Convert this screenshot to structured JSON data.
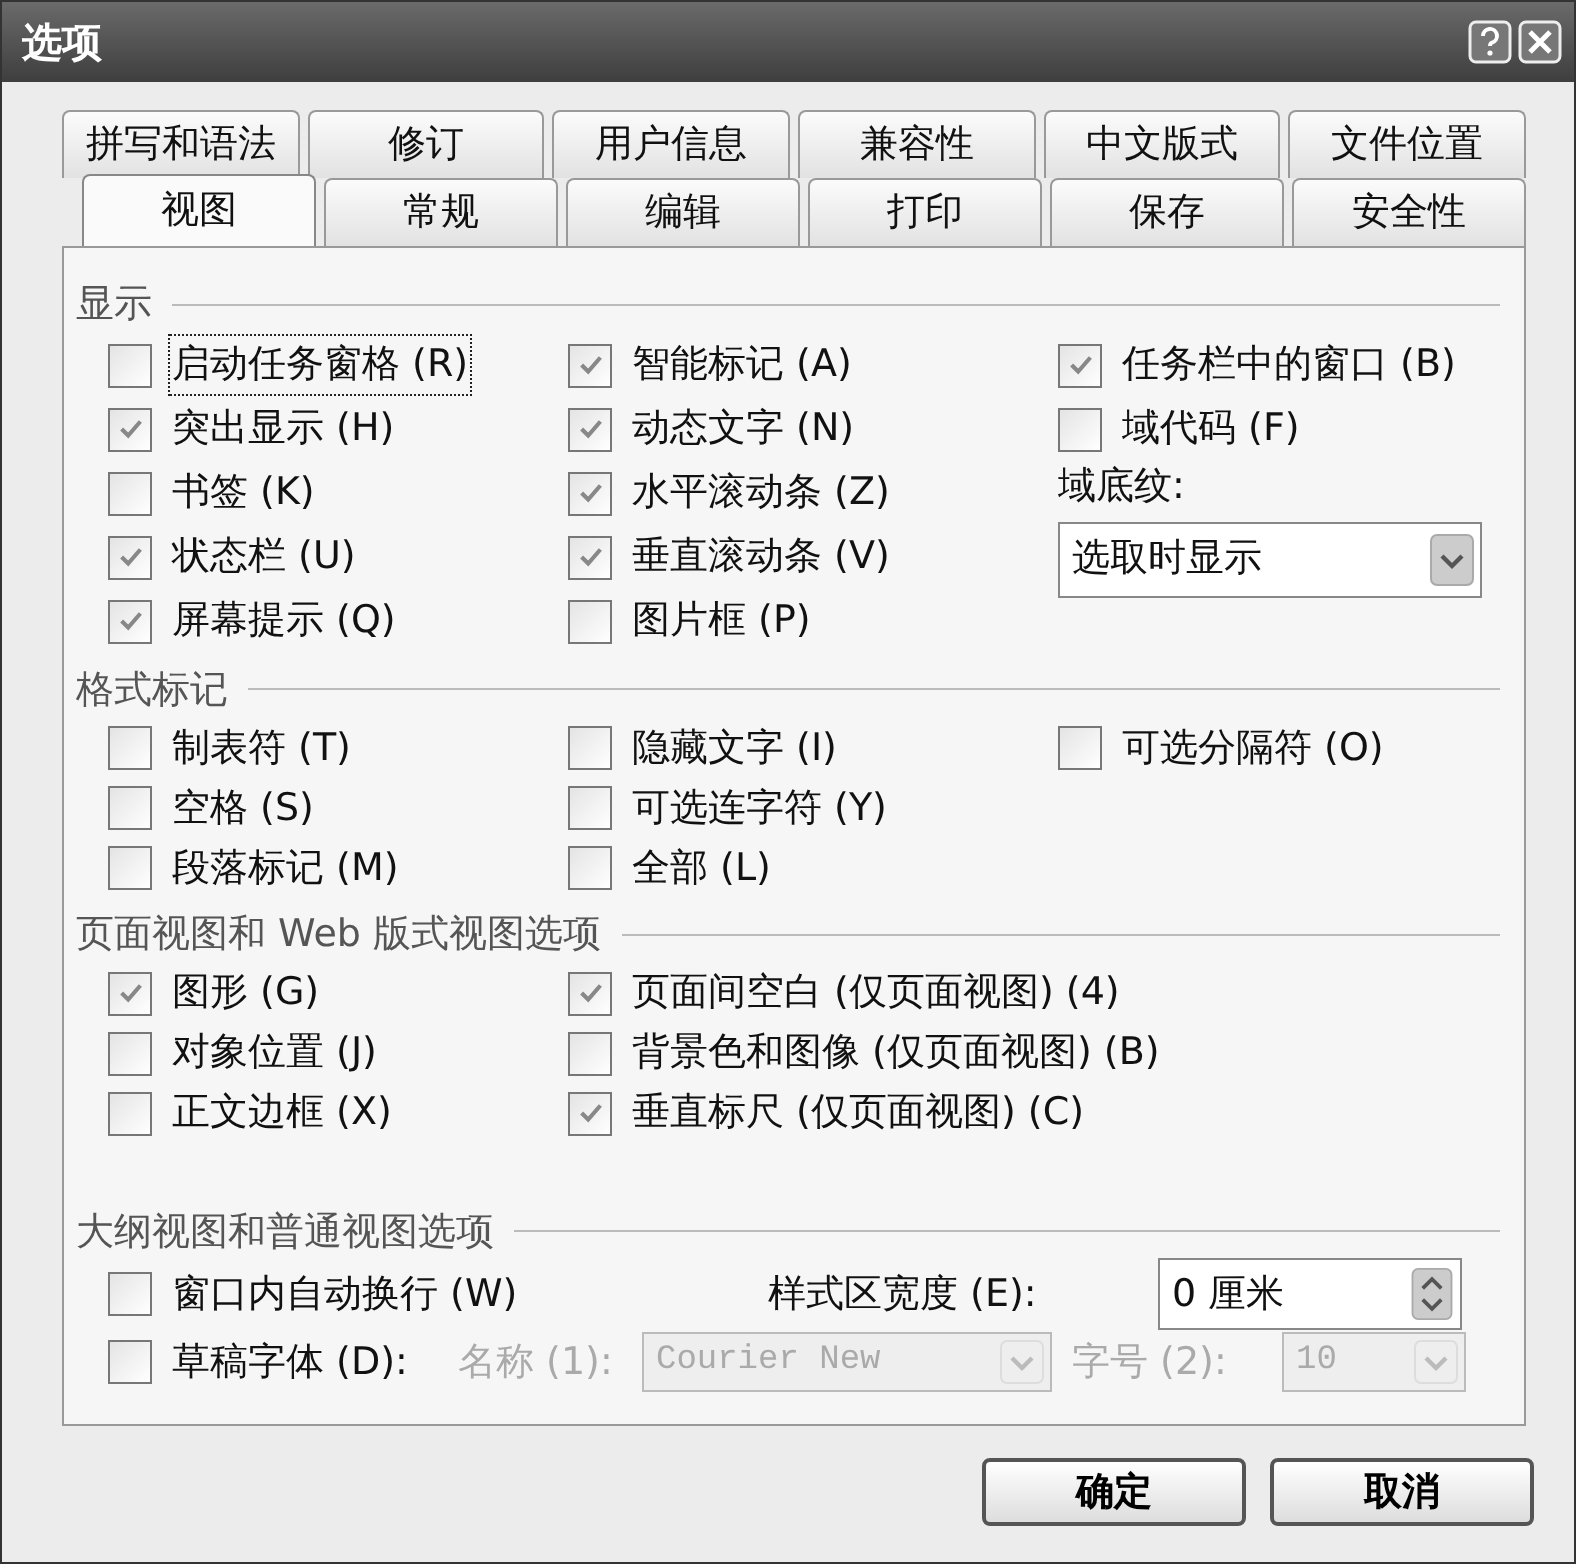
{
  "window": {
    "title": "选项"
  },
  "tab_rows": [
    [
      {
        "label": "拼写和语法",
        "selected": false
      },
      {
        "label": "修订",
        "selected": false
      },
      {
        "label": "用户信息",
        "selected": false
      },
      {
        "label": "兼容性",
        "selected": false
      },
      {
        "label": "中文版式",
        "selected": false
      },
      {
        "label": "文件位置",
        "selected": false
      }
    ],
    [
      {
        "label": "视图",
        "selected": true
      },
      {
        "label": "常规",
        "selected": false
      },
      {
        "label": "编辑",
        "selected": false
      },
      {
        "label": "打印",
        "selected": false
      },
      {
        "label": "保存",
        "selected": false
      },
      {
        "label": "安全性",
        "selected": false
      }
    ]
  ],
  "sections": [
    {
      "title": "显示",
      "columns": [
        [
          {
            "kind": "checkbox",
            "label": "启动任务窗格 (R)",
            "checked": false,
            "focused": true
          },
          {
            "kind": "checkbox",
            "label": "突出显示 (H)",
            "checked": true,
            "focused": false
          },
          {
            "kind": "checkbox",
            "label": "书签 (K)",
            "checked": false,
            "focused": false
          },
          {
            "kind": "checkbox",
            "label": "状态栏 (U)",
            "checked": true,
            "focused": false
          },
          {
            "kind": "checkbox",
            "label": "屏幕提示 (Q)",
            "checked": true,
            "focused": false
          }
        ],
        [
          {
            "kind": "checkbox",
            "label": "智能标记 (A)",
            "checked": true,
            "focused": false
          },
          {
            "kind": "checkbox",
            "label": "动态文字 (N)",
            "checked": true,
            "focused": false
          },
          {
            "kind": "checkbox",
            "label": "水平滚动条 (Z)",
            "checked": true,
            "focused": false
          },
          {
            "kind": "checkbox",
            "label": "垂直滚动条 (V)",
            "checked": true,
            "focused": false
          },
          {
            "kind": "checkbox",
            "label": "图片框 (P)",
            "checked": false,
            "focused": false
          }
        ],
        [
          {
            "kind": "checkbox",
            "label": "任务栏中的窗口 (B)",
            "checked": true,
            "focused": false
          },
          {
            "kind": "checkbox",
            "label": "域代码 (F)",
            "checked": false,
            "focused": false
          },
          {
            "kind": "label",
            "label": "域底纹:"
          },
          {
            "kind": "dropdown",
            "value": "选取时显示"
          }
        ]
      ]
    },
    {
      "title": "格式标记",
      "columns": [
        [
          {
            "kind": "checkbox",
            "label": "制表符 (T)",
            "checked": false,
            "focused": false
          },
          {
            "kind": "checkbox",
            "label": "空格 (S)",
            "checked": false,
            "focused": false
          },
          {
            "kind": "checkbox",
            "label": "段落标记 (M)",
            "checked": false,
            "focused": false
          }
        ],
        [
          {
            "kind": "checkbox",
            "label": "隐藏文字 (I)",
            "checked": false,
            "focused": false
          },
          {
            "kind": "checkbox",
            "label": "可选连字符 (Y)",
            "checked": false,
            "focused": false
          },
          {
            "kind": "checkbox",
            "label": "全部 (L)",
            "checked": false,
            "focused": false
          }
        ],
        [
          {
            "kind": "checkbox",
            "label": "可选分隔符 (O)",
            "checked": false,
            "focused": false
          }
        ]
      ]
    },
    {
      "title": "页面视图和 Web 版式视图选项",
      "columns": [
        [
          {
            "kind": "checkbox",
            "label": "图形 (G)",
            "checked": true,
            "focused": false
          },
          {
            "kind": "checkbox",
            "label": "对象位置 (J)",
            "checked": false,
            "focused": false
          },
          {
            "kind": "checkbox",
            "label": "正文边框 (X)",
            "checked": false,
            "focused": false
          }
        ],
        [
          {
            "kind": "checkbox",
            "label": "页面间空白 (仅页面视图) (4)",
            "checked": true,
            "focused": false
          },
          {
            "kind": "checkbox",
            "label": "背景色和图像 (仅页面视图) (B)",
            "checked": false,
            "focused": false
          },
          {
            "kind": "checkbox",
            "label": "垂直标尺 (仅页面视图) (C)",
            "checked": true,
            "focused": false
          }
        ]
      ]
    }
  ],
  "outline_section": {
    "title": "大纲视图和普通视图选项",
    "rows": [
      [
        {
          "kind": "checkbox",
          "label": "窗口内自动换行 (W)",
          "checked": false,
          "focused": false
        },
        {
          "kind": "label",
          "label": "样式区宽度 (E):",
          "disabled": false
        },
        {
          "kind": "spinner",
          "value": "0 厘米"
        }
      ],
      [
        {
          "kind": "checkbox",
          "label": "草稿字体 (D):",
          "checked": false,
          "focused": false
        },
        {
          "kind": "label",
          "label": "名称 (1):",
          "disabled": true
        },
        {
          "kind": "dropdown",
          "value": "Courier New",
          "disabled": true
        },
        {
          "kind": "label",
          "label": "字号 (2):",
          "disabled": true
        },
        {
          "kind": "dropdown",
          "value": "10",
          "disabled": true
        }
      ]
    ]
  },
  "buttons": [
    "确定",
    "取消"
  ]
}
